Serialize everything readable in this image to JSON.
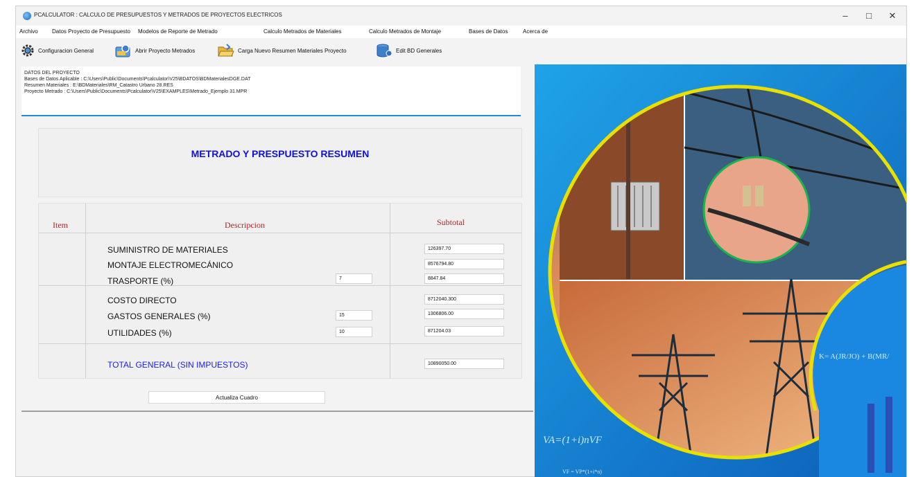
{
  "window": {
    "title": "PCALCULATOR : CALCULO DE PRESUPUESTOS Y METRADOS DE PROYECTOS ELECTRICOS",
    "controls": {
      "minimize": "–",
      "maximize": "□",
      "close": "✕"
    }
  },
  "menu": [
    "Archivo",
    "Datos Proyecto de Presupuesto",
    "Modelos de Reporte de Metrado",
    "Calculo Metrados de Materiales",
    "Calculo Metrados de Montaje",
    "Bases de Datos",
    "Acerca de"
  ],
  "toolbar": {
    "config_label": "Configuracion General",
    "open_label": "Abrir Proyecto Metrados",
    "load_label": "Carga Nuevo Resumen Materiales Proyecto",
    "edit_db_label": "Edit BD Generales"
  },
  "project_info": {
    "heading": "DATOS DEL PROYECTO",
    "line1": "Bases de Datos Aplicable : C:\\Users\\Public\\Documents\\Pcalculator\\V25\\BDATOS\\BDMaterialesDGE.DAT",
    "line2": "Resumen Materiales : E:\\BDMateriales\\RM_Catastro Urbano 28.RES",
    "line3": "Proyecto Metrado : C:\\Users\\Public\\Documents\\Pcalculator\\V25\\EXAMPLES\\Metrado_Ejemplo 31.MPR"
  },
  "summary": {
    "title": "METRADO Y PRESPUESTO RESUMEN",
    "headers": {
      "item": "Item",
      "descripcion": "Descripcion",
      "subtotal": "Subtotal"
    },
    "rows": [
      {
        "label": "SUMINISTRO DE MATERIALES",
        "percent": "",
        "subtotal": "126397.70"
      },
      {
        "label": "MONTAJE  ELECTROMECÁNICO",
        "percent": "",
        "subtotal": "8576794.80"
      },
      {
        "label": "TRASPORTE (%)",
        "percent": "7",
        "subtotal": "8847.84"
      },
      {
        "label": "COSTO DIRECTO",
        "percent": "",
        "subtotal": "8712040.300"
      },
      {
        "label": "GASTOS GENERALES (%)",
        "percent": "15",
        "subtotal": "1306806.00"
      },
      {
        "label": "UTILIDADES (%)",
        "percent": "10",
        "subtotal": "871204.03"
      }
    ],
    "total": {
      "label": "TOTAL GENERAL (SIN IMPUESTOS)",
      "subtotal": "10890050.00"
    },
    "update_button": "Actualiza Cuadro"
  },
  "colors": {
    "accent": "#1e88e5",
    "title_blue": "#1010dd",
    "header_red": "#b22222",
    "total_blue": "#1a1aff"
  },
  "icons": [
    "gear-icon",
    "open-project-icon",
    "load-folder-icon",
    "database-icon"
  ]
}
